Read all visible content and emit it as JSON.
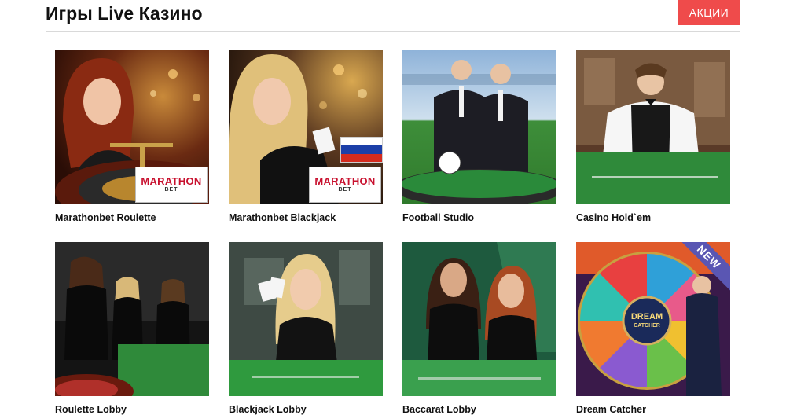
{
  "header": {
    "title": "Игры Live Казино",
    "promo_button": "АКЦИИ"
  },
  "games": [
    {
      "name": "Marathonbet Roulette",
      "logo_line1": "MARATHON",
      "logo_line2": "BET"
    },
    {
      "name": "Marathonbet Blackjack",
      "logo_line1": "MARATHON",
      "logo_line2": "BET"
    },
    {
      "name": "Football Studio"
    },
    {
      "name": "Casino Hold`em"
    },
    {
      "name": "Roulette Lobby"
    },
    {
      "name": "Blackjack Lobby"
    },
    {
      "name": "Baccarat Lobby"
    },
    {
      "name": "Dream Catcher",
      "badge": "NEW",
      "logo_line1": "DREAM",
      "logo_line2": "CATCHER"
    }
  ],
  "colors": {
    "accent": "#ef4b4b",
    "new_badge": "#5a56b3",
    "marathon_red": "#c8102e"
  }
}
